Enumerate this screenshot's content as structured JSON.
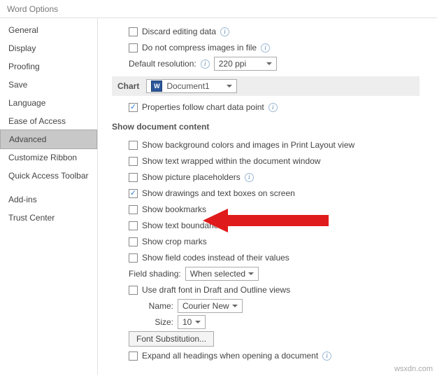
{
  "window_title": "Word Options",
  "sidebar": {
    "items": [
      {
        "label": "General"
      },
      {
        "label": "Display"
      },
      {
        "label": "Proofing"
      },
      {
        "label": "Save"
      },
      {
        "label": "Language"
      },
      {
        "label": "Ease of Access"
      },
      {
        "label": "Advanced",
        "selected": true
      },
      {
        "label": "Customize Ribbon"
      },
      {
        "label": "Quick Access Toolbar"
      },
      {
        "label": "Add-ins"
      },
      {
        "label": "Trust Center"
      }
    ]
  },
  "top": {
    "discard": "Discard editing data",
    "compress": "Do not compress images in file",
    "resolution_label": "Default resolution:",
    "resolution_value": "220 ppi"
  },
  "chart": {
    "title": "Chart",
    "doc": "Document1",
    "follow": "Properties follow chart data point"
  },
  "content": {
    "title": "Show document content",
    "bg": "Show background colors and images in Print Layout view",
    "wrap": "Show text wrapped within the document window",
    "placeholders": "Show picture placeholders",
    "drawings": "Show drawings and text boxes on screen",
    "bookmarks": "Show bookmarks",
    "bounds": "Show text boundaries",
    "crop": "Show crop marks",
    "fieldcodes": "Show field codes instead of their values",
    "shading_label": "Field shading:",
    "shading_value": "When selected",
    "draftfont": "Use draft font in Draft and Outline views",
    "name_label": "Name:",
    "name_value": "Courier New",
    "size_label": "Size:",
    "size_value": "10",
    "fontsub": "Font Substitution...",
    "expand": "Expand all headings when opening a document"
  },
  "watermark": "wsxdn.com"
}
